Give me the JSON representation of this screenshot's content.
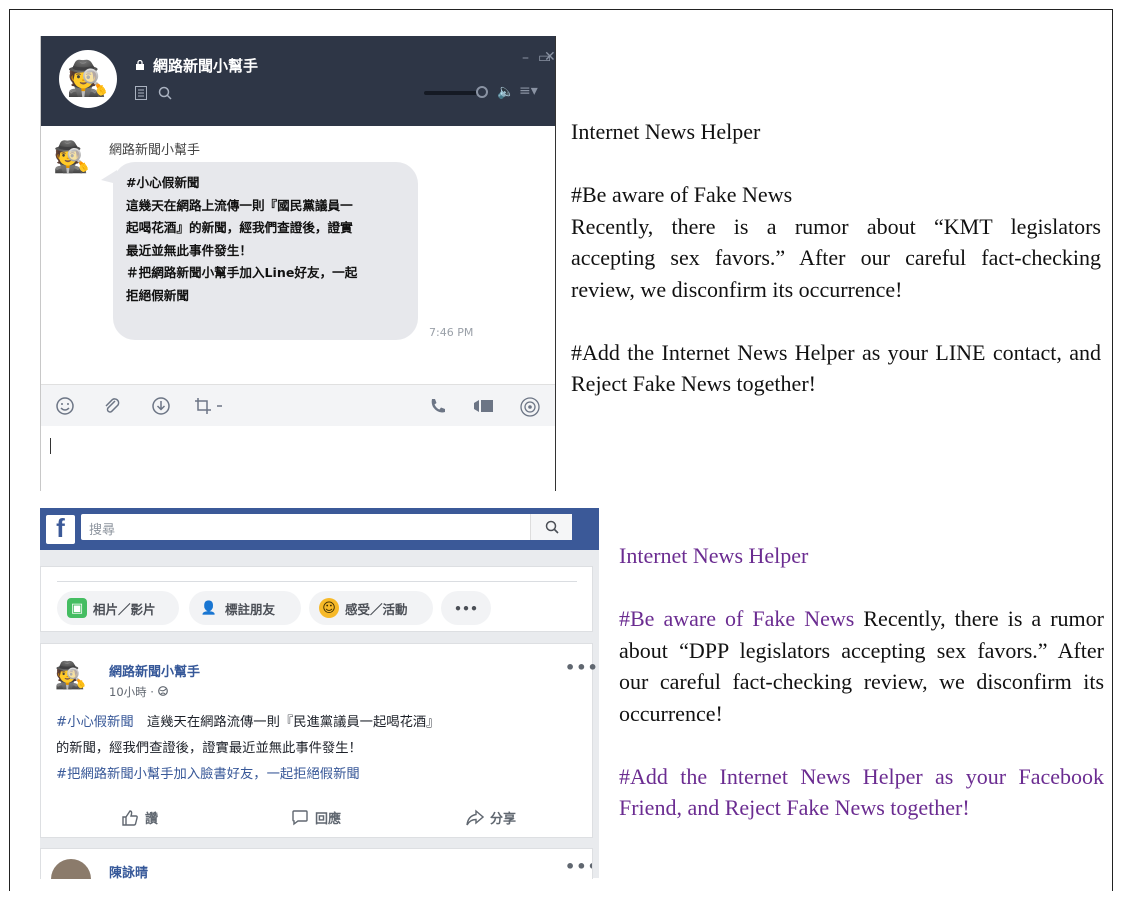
{
  "line": {
    "window_title": "網路新聞小幫手",
    "window_controls": [
      "–",
      "▭",
      "✕"
    ],
    "sender": "網路新聞小幫手",
    "message_lines": [
      "#小心假新聞",
      "這幾天在網路上流傳一則『國民黨議員一",
      "起喝花酒』的新聞，經我們查證後，證實",
      "最近並無此事件發生！",
      "＃把網路新聞小幫手加入Line好友，一起",
      "拒絕假新聞"
    ],
    "message_time": "7:46 PM",
    "toolbar_icons": [
      "emoji-icon",
      "attachment-icon",
      "download-icon",
      "crop-icon",
      "phone-icon",
      "video-icon",
      "broadcast-icon"
    ],
    "volume_level": 0.9
  },
  "english_line": {
    "heading": "Internet News Helper",
    "line1": "#Be aware of Fake News",
    "paragraph": "Recently, there is a rumor about “KMT legislators accepting sex favors.” After our careful fact-checking review, we disconfirm its occurrence!",
    "closing": "#Add the Internet News Helper as your LINE contact, and Reject Fake News together!"
  },
  "facebook": {
    "search_placeholder": "搜尋",
    "compose_buttons": [
      {
        "label": "相片／影片",
        "icon": "photo-icon"
      },
      {
        "label": "標註朋友",
        "icon": "tag-friend-icon"
      },
      {
        "label": "感受／活動",
        "icon": "feeling-icon"
      }
    ],
    "compose_more": "•••",
    "post": {
      "author": "網路新聞小幫手",
      "time": "10小時 · ",
      "tag1": "#小心假新聞",
      "line1_rest": "　這幾天在網路流傳一則『民進黨議員一起喝花酒』",
      "line2": "的新聞，經我們查證後，證實最近並無此事件發生！",
      "line3": "#把網路新聞小幫手加入臉書好友，一起拒絕假新聞",
      "more": "•••"
    },
    "actions": [
      {
        "label": "讚",
        "icon": "like-icon"
      },
      {
        "label": "回應",
        "icon": "comment-icon"
      },
      {
        "label": "分享",
        "icon": "share-icon"
      }
    ],
    "post2": {
      "author": "陳詠晴",
      "more": "•••"
    }
  },
  "english_fb": {
    "heading": "Internet News Helper",
    "tag": "#Be aware of Fake News",
    "paragraph": " Recently, there is a rumor about “DPP legislators accepting sex favors.” After our careful fact-checking review, we disconfirm its occurrence!",
    "closing": "#Add the Internet News Helper as your Facebook Friend, and Reject Fake News together!"
  },
  "colors": {
    "line_header": "#2e3646",
    "fb_blue": "#3b5998",
    "purple_text": "#6b2c91"
  }
}
